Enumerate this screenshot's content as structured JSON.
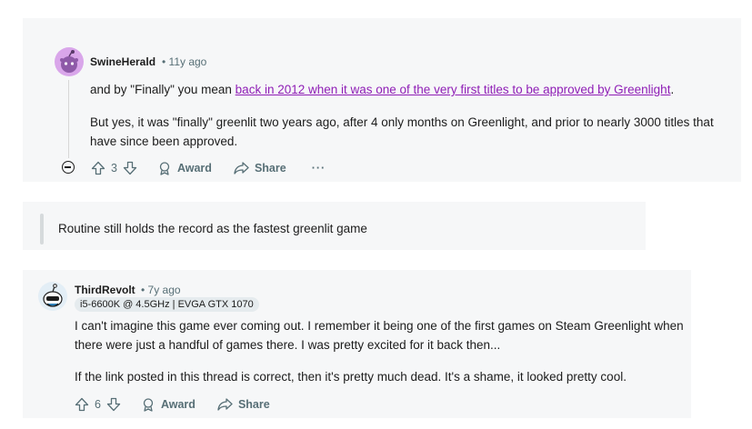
{
  "comments": [
    {
      "username": "SwineHerald",
      "age": "• 11y ago",
      "body": {
        "p1_prefix": "and by \"Finally\" you mean ",
        "p1_link": "back in 2012 when it was one of the very first titles to be approved by Greenlight",
        "p1_suffix": ".",
        "p2": "But yes, it was \"finally\" greenlit two years ago, after 4 only months on Greenlight, and prior to nearly 3000 titles that have since been approved."
      },
      "votes": "3",
      "award_label": "Award",
      "share_label": "Share",
      "more_label": "···"
    },
    {
      "quote": "Routine still holds the record as the fastest greenlit game"
    },
    {
      "username": "ThirdRevolt",
      "age": "• 7y ago",
      "flair": "i5-6600K @ 4.5GHz | EVGA GTX 1070",
      "body": {
        "p1": "I can't imagine this game ever coming out. I remember it being one of the first games on Steam Greenlight when there were just a handful of games there. I was pretty excited for it back then...",
        "p2": "If the link posted in this thread is correct, then it's pretty much dead. It's a shame, it looked pretty cool."
      },
      "votes": "6",
      "award_label": "Award",
      "share_label": "Share"
    }
  ],
  "colors": {
    "panel_bg": "#f6f7f8",
    "link": "#8f1eb6",
    "meta": "#576f76"
  },
  "icons": [
    "snoo-avatar-icon",
    "collapse-thread-icon",
    "upvote-icon",
    "downvote-icon",
    "award-icon",
    "share-icon",
    "more-options-icon"
  ]
}
